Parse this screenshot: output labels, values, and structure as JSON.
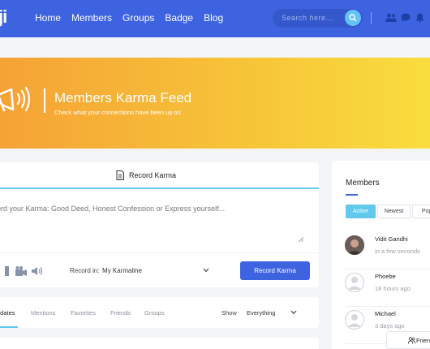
{
  "navbar": {
    "logo": "ji",
    "links": [
      "Home",
      "Members",
      "Groups",
      "Badge",
      "Blog"
    ],
    "search_placeholder": "Search here...",
    "icons": [
      "members-icon",
      "messages-icon",
      "notifications-icon"
    ]
  },
  "banner": {
    "title": "Members Karma Feed",
    "subtitle": "Check what your connections have been up to!"
  },
  "record": {
    "title": "Record Karma",
    "placeholder": "ord your Karma: Good Deed, Honest Confession or Express yourself...",
    "record_in_label": "Record in:",
    "record_in_value": "My Karmaline",
    "button": "Record Karma"
  },
  "feed_tabs": {
    "tabs": [
      "odates",
      "Mentions",
      "Favorites",
      "Friends",
      "Groups"
    ],
    "show_label": "Show",
    "show_value": "Everything"
  },
  "members": {
    "title": "Members",
    "filters": [
      "Active",
      "Newest",
      "Popu"
    ],
    "list": [
      {
        "name": "Vidit Gandhi",
        "time": "in a few seconds"
      },
      {
        "name": "Phoebe",
        "time": "18 hours ago"
      },
      {
        "name": "Michael",
        "time": "3 days ago"
      }
    ],
    "friends_button": "Frien"
  },
  "colors": {
    "primary": "#3d63e0",
    "accent": "#60c9ec",
    "banner_start": "#f5a236",
    "banner_end": "#f9dd3e"
  }
}
